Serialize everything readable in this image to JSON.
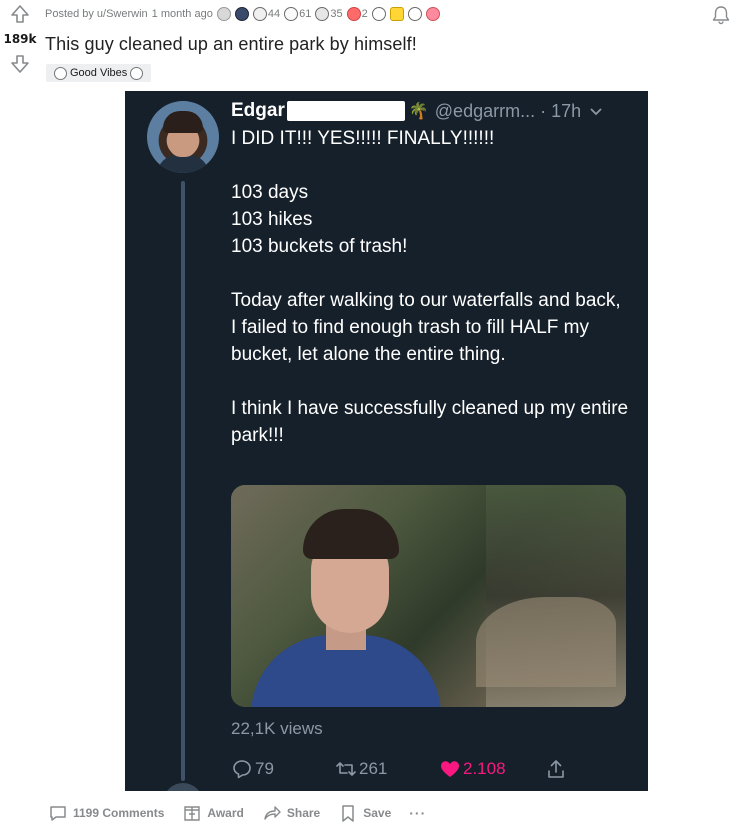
{
  "post": {
    "score": "189k",
    "posted_by": "Posted by",
    "author": "u/Swerwin",
    "time": "1 month ago",
    "title": "This guy cleaned up an entire park by himself!",
    "flair": "Good Vibes",
    "awards": [
      {
        "icon": "silver-award-icon",
        "count": ""
      },
      {
        "icon": "helpful-award-icon",
        "count": ""
      },
      {
        "icon": "wholesome-award-icon",
        "count": "44"
      },
      {
        "icon": "hugz-award-icon",
        "count": "61"
      },
      {
        "icon": "take-my-energy-award-icon",
        "count": "35"
      },
      {
        "icon": "heart-award-icon",
        "count": "2"
      },
      {
        "icon": "starstruck-award-icon",
        "count": ""
      },
      {
        "icon": "upvote-award-icon",
        "count": ""
      },
      {
        "icon": "party-award-icon",
        "count": ""
      },
      {
        "icon": "cake-award-icon",
        "count": ""
      }
    ]
  },
  "tweet": {
    "name": "Edgar",
    "handle": "@edgarrm... · 17h",
    "lines": [
      "I DID IT!!! YES!!!!! FINALLY!!!!!!",
      "",
      "103 days",
      "103 hikes",
      "103 buckets of trash!",
      "",
      "Today after walking to our waterfalls and back, I failed to find enough trash to fill HALF my bucket, let alone the entire thing.",
      "",
      "I think I have successfully cleaned up my entire park!!!"
    ],
    "views": "22,1K views",
    "replies": "79",
    "retweets": "261",
    "likes": "2.108",
    "colors": {
      "background": "#16202a",
      "like": "#f91880",
      "muted": "#8b98a5"
    }
  },
  "footer": {
    "comments": "1199 Comments",
    "award": "Award",
    "share": "Share",
    "save": "Save",
    "more": "···"
  }
}
